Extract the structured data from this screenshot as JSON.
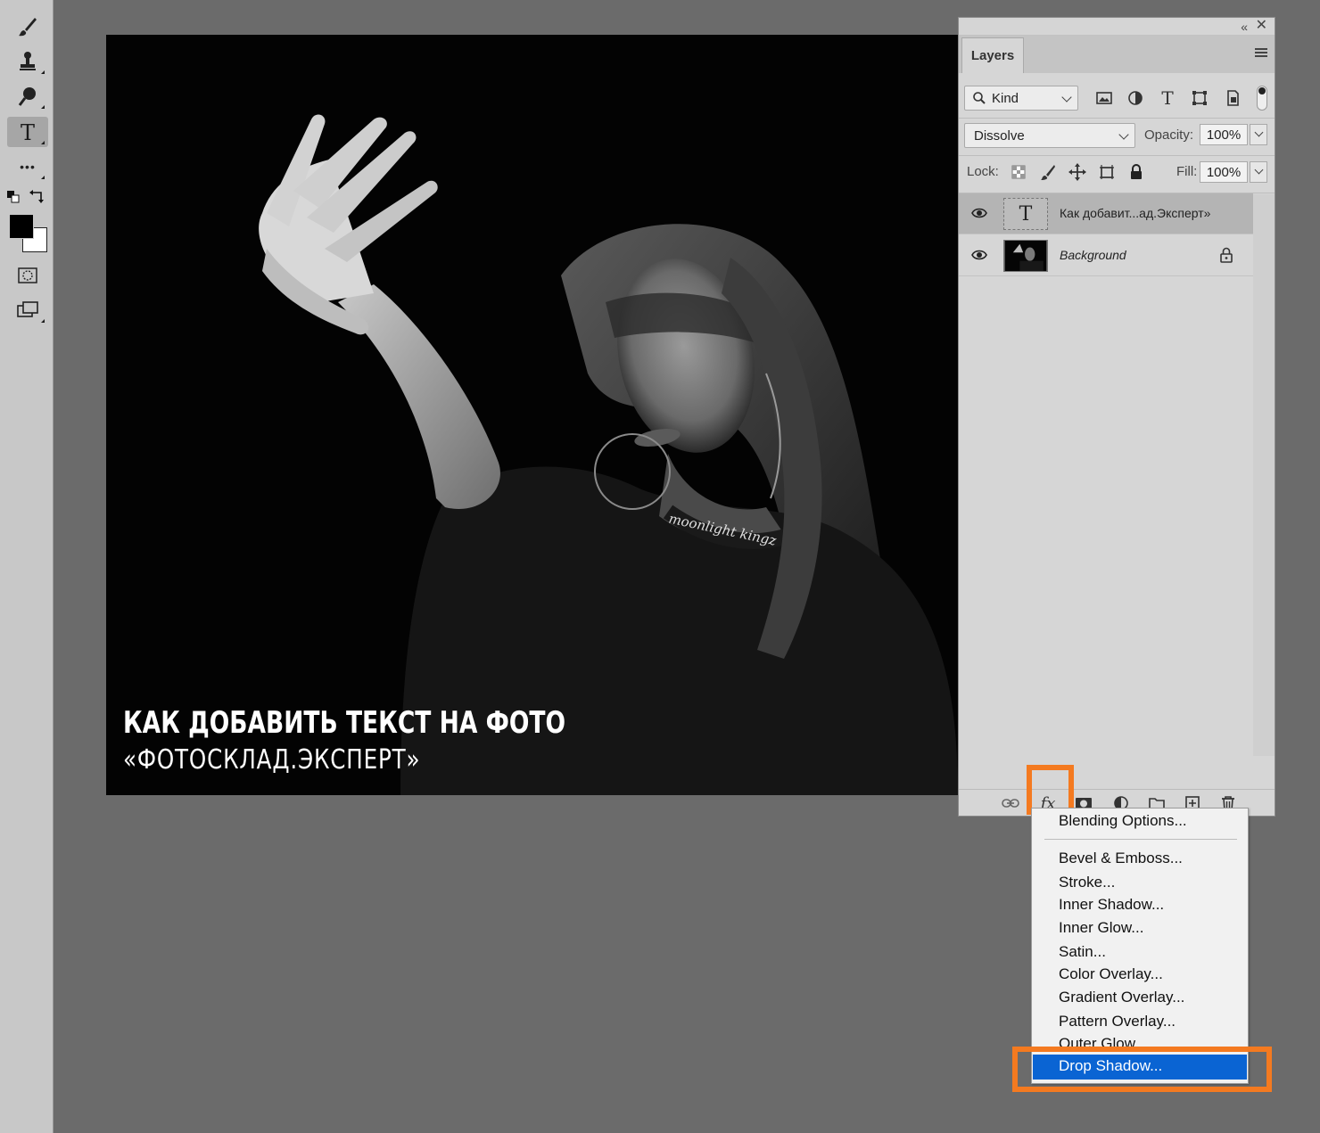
{
  "toolbar": {
    "tools": [
      "brush-tool",
      "clone-stamp-tool",
      "dodge-tool",
      "type-tool",
      "edit-toolbar",
      "default-colors",
      "switch-colors",
      "quick-mask",
      "screen-mode"
    ],
    "active_tool": "type-tool",
    "type_tool_glyph": "T",
    "more_glyph": "•••",
    "foreground_color": "#000000",
    "background_color": "#ffffff"
  },
  "canvas": {
    "caption_line1": "КАК ДОБАВИТЬ ТЕКСТ НА ФОТО",
    "caption_line2": "«ФОТОСКЛАД.ЭКСПЕРТ»",
    "shirt_text": "moonlight kingz"
  },
  "layers_panel": {
    "collapse_glyph": "«",
    "close_glyph": "✕",
    "tab_label": "Layers",
    "filter": {
      "label": "Kind",
      "icons": [
        "pixel-filter-icon",
        "adjustment-filter-icon",
        "type-filter-icon",
        "shape-filter-icon",
        "smart-object-filter-icon",
        "filter-toggle-icon"
      ],
      "type_glyph": "T"
    },
    "blend_mode": "Dissolve",
    "opacity_label": "Opacity:",
    "opacity_value": "100%",
    "lock_label": "Lock:",
    "lock_icons": [
      "lock-transparent-pixels-icon",
      "lock-image-pixels-icon",
      "lock-position-icon",
      "lock-artboard-icon",
      "lock-all-icon"
    ],
    "fill_label": "Fill:",
    "fill_value": "100%",
    "layers": [
      {
        "name": "Как добавит...ад.Эксперт»",
        "type": "text",
        "thumb_glyph": "T",
        "visible": true,
        "selected": true
      },
      {
        "name": "Background",
        "type": "image",
        "visible": true,
        "locked": true,
        "selected": false
      }
    ],
    "footer": {
      "buttons": [
        "link-layers-icon",
        "fx-icon",
        "layer-mask-icon",
        "adjustment-layer-icon",
        "group-folder-icon",
        "new-layer-icon",
        "trash-icon"
      ],
      "fx_label": "fx"
    }
  },
  "fx_menu": {
    "items": [
      "Blending Options...",
      "Bevel & Emboss...",
      "Stroke...",
      "Inner Shadow...",
      "Inner Glow...",
      "Satin...",
      "Color Overlay...",
      "Gradient Overlay...",
      "Pattern Overlay...",
      "Outer Glow...",
      "Drop Shadow..."
    ],
    "highlighted": "Drop Shadow..."
  },
  "colors": {
    "highlight_orange": "#f47a20",
    "menu_hover_blue": "#0a64d3"
  }
}
